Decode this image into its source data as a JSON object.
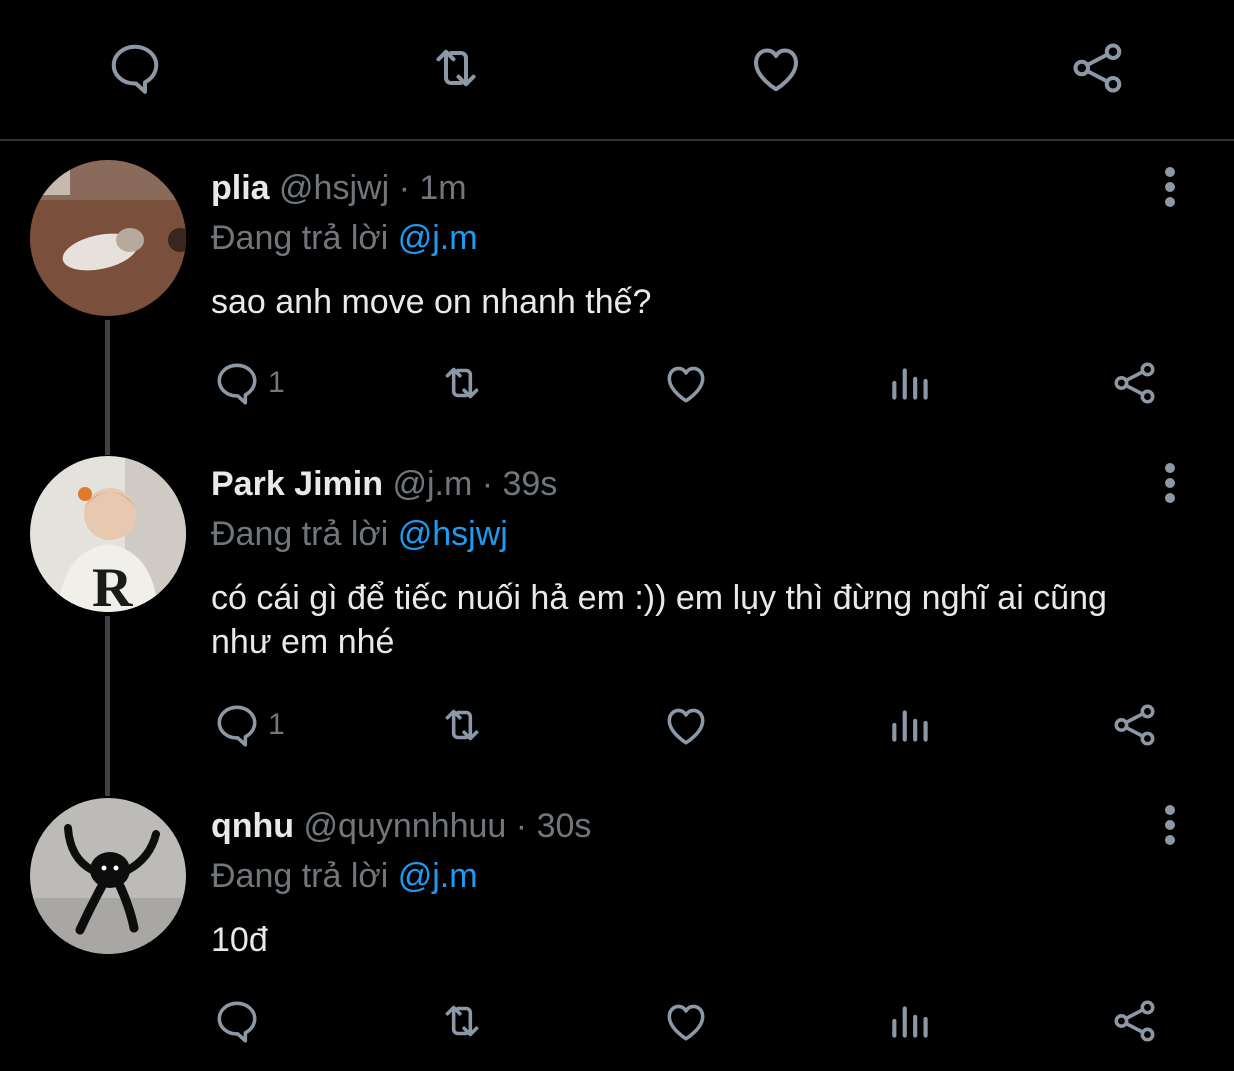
{
  "top_actions": {
    "reply_icon": "reply-icon",
    "retweet_icon": "retweet-icon",
    "like_icon": "like-icon",
    "share_icon": "share-icon"
  },
  "tweets": [
    {
      "avatar": "avatar-dog",
      "name": "plia",
      "handle": "@hsjwj",
      "separator": "·",
      "time": "1m",
      "reply_prefix": "Đang trả lời",
      "reply_to": "@j.m",
      "text": "sao anh move on nhanh thế?",
      "reply_count": "1"
    },
    {
      "avatar": "avatar-person",
      "name": "Park Jimin",
      "handle": "@j.m",
      "separator": "·",
      "time": "39s",
      "reply_prefix": "Đang trả lời",
      "reply_to": "@hsjwj",
      "text": "có cái gì để tiếc nuối hả em :)) em lụy thì đừng nghĩ ai cũng như em nhé",
      "reply_count": "1"
    },
    {
      "avatar": "avatar-cat",
      "name": "qnhu",
      "handle": "@quynnhhuu",
      "separator": "·",
      "time": "30s",
      "reply_prefix": "Đang trả lời",
      "reply_to": "@j.m",
      "text": "10đ",
      "reply_count": ""
    }
  ],
  "colors": {
    "background": "#000000",
    "text": "#e7e9ea",
    "muted": "#71767b",
    "icon": "#8b98a5",
    "link": "#1d9bf0",
    "divider": "#2f3336"
  }
}
